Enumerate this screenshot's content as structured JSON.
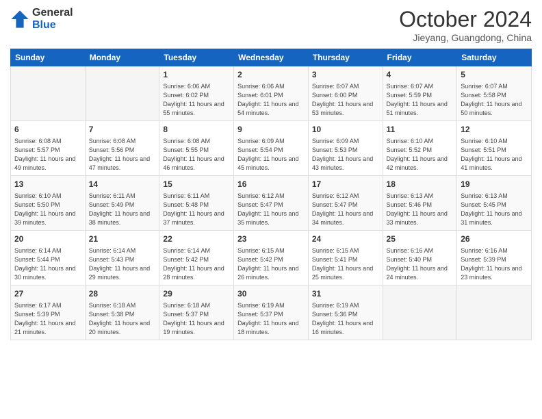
{
  "header": {
    "logo_general": "General",
    "logo_blue": "Blue",
    "month_title": "October 2024",
    "location": "Jieyang, Guangdong, China"
  },
  "days_of_week": [
    "Sunday",
    "Monday",
    "Tuesday",
    "Wednesday",
    "Thursday",
    "Friday",
    "Saturday"
  ],
  "weeks": [
    [
      {
        "day": "",
        "sunrise": "",
        "sunset": "",
        "daylight": ""
      },
      {
        "day": "",
        "sunrise": "",
        "sunset": "",
        "daylight": ""
      },
      {
        "day": "1",
        "sunrise": "Sunrise: 6:06 AM",
        "sunset": "Sunset: 6:02 PM",
        "daylight": "Daylight: 11 hours and 55 minutes."
      },
      {
        "day": "2",
        "sunrise": "Sunrise: 6:06 AM",
        "sunset": "Sunset: 6:01 PM",
        "daylight": "Daylight: 11 hours and 54 minutes."
      },
      {
        "day": "3",
        "sunrise": "Sunrise: 6:07 AM",
        "sunset": "Sunset: 6:00 PM",
        "daylight": "Daylight: 11 hours and 53 minutes."
      },
      {
        "day": "4",
        "sunrise": "Sunrise: 6:07 AM",
        "sunset": "Sunset: 5:59 PM",
        "daylight": "Daylight: 11 hours and 51 minutes."
      },
      {
        "day": "5",
        "sunrise": "Sunrise: 6:07 AM",
        "sunset": "Sunset: 5:58 PM",
        "daylight": "Daylight: 11 hours and 50 minutes."
      }
    ],
    [
      {
        "day": "6",
        "sunrise": "Sunrise: 6:08 AM",
        "sunset": "Sunset: 5:57 PM",
        "daylight": "Daylight: 11 hours and 49 minutes."
      },
      {
        "day": "7",
        "sunrise": "Sunrise: 6:08 AM",
        "sunset": "Sunset: 5:56 PM",
        "daylight": "Daylight: 11 hours and 47 minutes."
      },
      {
        "day": "8",
        "sunrise": "Sunrise: 6:08 AM",
        "sunset": "Sunset: 5:55 PM",
        "daylight": "Daylight: 11 hours and 46 minutes."
      },
      {
        "day": "9",
        "sunrise": "Sunrise: 6:09 AM",
        "sunset": "Sunset: 5:54 PM",
        "daylight": "Daylight: 11 hours and 45 minutes."
      },
      {
        "day": "10",
        "sunrise": "Sunrise: 6:09 AM",
        "sunset": "Sunset: 5:53 PM",
        "daylight": "Daylight: 11 hours and 43 minutes."
      },
      {
        "day": "11",
        "sunrise": "Sunrise: 6:10 AM",
        "sunset": "Sunset: 5:52 PM",
        "daylight": "Daylight: 11 hours and 42 minutes."
      },
      {
        "day": "12",
        "sunrise": "Sunrise: 6:10 AM",
        "sunset": "Sunset: 5:51 PM",
        "daylight": "Daylight: 11 hours and 41 minutes."
      }
    ],
    [
      {
        "day": "13",
        "sunrise": "Sunrise: 6:10 AM",
        "sunset": "Sunset: 5:50 PM",
        "daylight": "Daylight: 11 hours and 39 minutes."
      },
      {
        "day": "14",
        "sunrise": "Sunrise: 6:11 AM",
        "sunset": "Sunset: 5:49 PM",
        "daylight": "Daylight: 11 hours and 38 minutes."
      },
      {
        "day": "15",
        "sunrise": "Sunrise: 6:11 AM",
        "sunset": "Sunset: 5:48 PM",
        "daylight": "Daylight: 11 hours and 37 minutes."
      },
      {
        "day": "16",
        "sunrise": "Sunrise: 6:12 AM",
        "sunset": "Sunset: 5:47 PM",
        "daylight": "Daylight: 11 hours and 35 minutes."
      },
      {
        "day": "17",
        "sunrise": "Sunrise: 6:12 AM",
        "sunset": "Sunset: 5:47 PM",
        "daylight": "Daylight: 11 hours and 34 minutes."
      },
      {
        "day": "18",
        "sunrise": "Sunrise: 6:13 AM",
        "sunset": "Sunset: 5:46 PM",
        "daylight": "Daylight: 11 hours and 33 minutes."
      },
      {
        "day": "19",
        "sunrise": "Sunrise: 6:13 AM",
        "sunset": "Sunset: 5:45 PM",
        "daylight": "Daylight: 11 hours and 31 minutes."
      }
    ],
    [
      {
        "day": "20",
        "sunrise": "Sunrise: 6:14 AM",
        "sunset": "Sunset: 5:44 PM",
        "daylight": "Daylight: 11 hours and 30 minutes."
      },
      {
        "day": "21",
        "sunrise": "Sunrise: 6:14 AM",
        "sunset": "Sunset: 5:43 PM",
        "daylight": "Daylight: 11 hours and 29 minutes."
      },
      {
        "day": "22",
        "sunrise": "Sunrise: 6:14 AM",
        "sunset": "Sunset: 5:42 PM",
        "daylight": "Daylight: 11 hours and 28 minutes."
      },
      {
        "day": "23",
        "sunrise": "Sunrise: 6:15 AM",
        "sunset": "Sunset: 5:42 PM",
        "daylight": "Daylight: 11 hours and 26 minutes."
      },
      {
        "day": "24",
        "sunrise": "Sunrise: 6:15 AM",
        "sunset": "Sunset: 5:41 PM",
        "daylight": "Daylight: 11 hours and 25 minutes."
      },
      {
        "day": "25",
        "sunrise": "Sunrise: 6:16 AM",
        "sunset": "Sunset: 5:40 PM",
        "daylight": "Daylight: 11 hours and 24 minutes."
      },
      {
        "day": "26",
        "sunrise": "Sunrise: 6:16 AM",
        "sunset": "Sunset: 5:39 PM",
        "daylight": "Daylight: 11 hours and 23 minutes."
      }
    ],
    [
      {
        "day": "27",
        "sunrise": "Sunrise: 6:17 AM",
        "sunset": "Sunset: 5:39 PM",
        "daylight": "Daylight: 11 hours and 21 minutes."
      },
      {
        "day": "28",
        "sunrise": "Sunrise: 6:18 AM",
        "sunset": "Sunset: 5:38 PM",
        "daylight": "Daylight: 11 hours and 20 minutes."
      },
      {
        "day": "29",
        "sunrise": "Sunrise: 6:18 AM",
        "sunset": "Sunset: 5:37 PM",
        "daylight": "Daylight: 11 hours and 19 minutes."
      },
      {
        "day": "30",
        "sunrise": "Sunrise: 6:19 AM",
        "sunset": "Sunset: 5:37 PM",
        "daylight": "Daylight: 11 hours and 18 minutes."
      },
      {
        "day": "31",
        "sunrise": "Sunrise: 6:19 AM",
        "sunset": "Sunset: 5:36 PM",
        "daylight": "Daylight: 11 hours and 16 minutes."
      },
      {
        "day": "",
        "sunrise": "",
        "sunset": "",
        "daylight": ""
      },
      {
        "day": "",
        "sunrise": "",
        "sunset": "",
        "daylight": ""
      }
    ]
  ]
}
